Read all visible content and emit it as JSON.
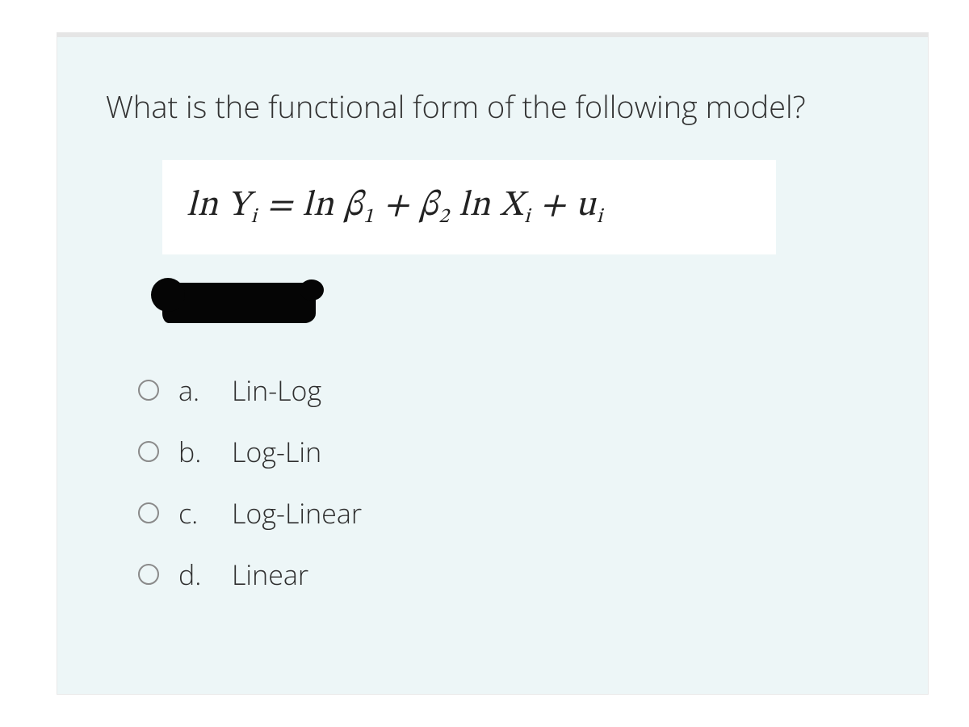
{
  "question": {
    "prompt": "What is the functional form of the following model?",
    "equation": {
      "lhs_ln": "ln",
      "lhs_var": "Y",
      "lhs_sub": "i",
      "eq": " = ",
      "rhs1_ln": "ln",
      "rhs1_beta": "β",
      "rhs1_betasub": "1",
      "plus1": " + ",
      "rhs2_beta": "β",
      "rhs2_betasub": "2",
      "rhs2_ln": " ln",
      "rhs2_var": " X",
      "rhs2_sub": "i",
      "plus2": " + ",
      "err": "u",
      "err_sub": "i"
    }
  },
  "options": [
    {
      "letter": "a.",
      "label": "Lin-Log"
    },
    {
      "letter": "b.",
      "label": "Log-Lin"
    },
    {
      "letter": "c.",
      "label": "Log-Linear"
    },
    {
      "letter": "d.",
      "label": "Linear"
    }
  ]
}
